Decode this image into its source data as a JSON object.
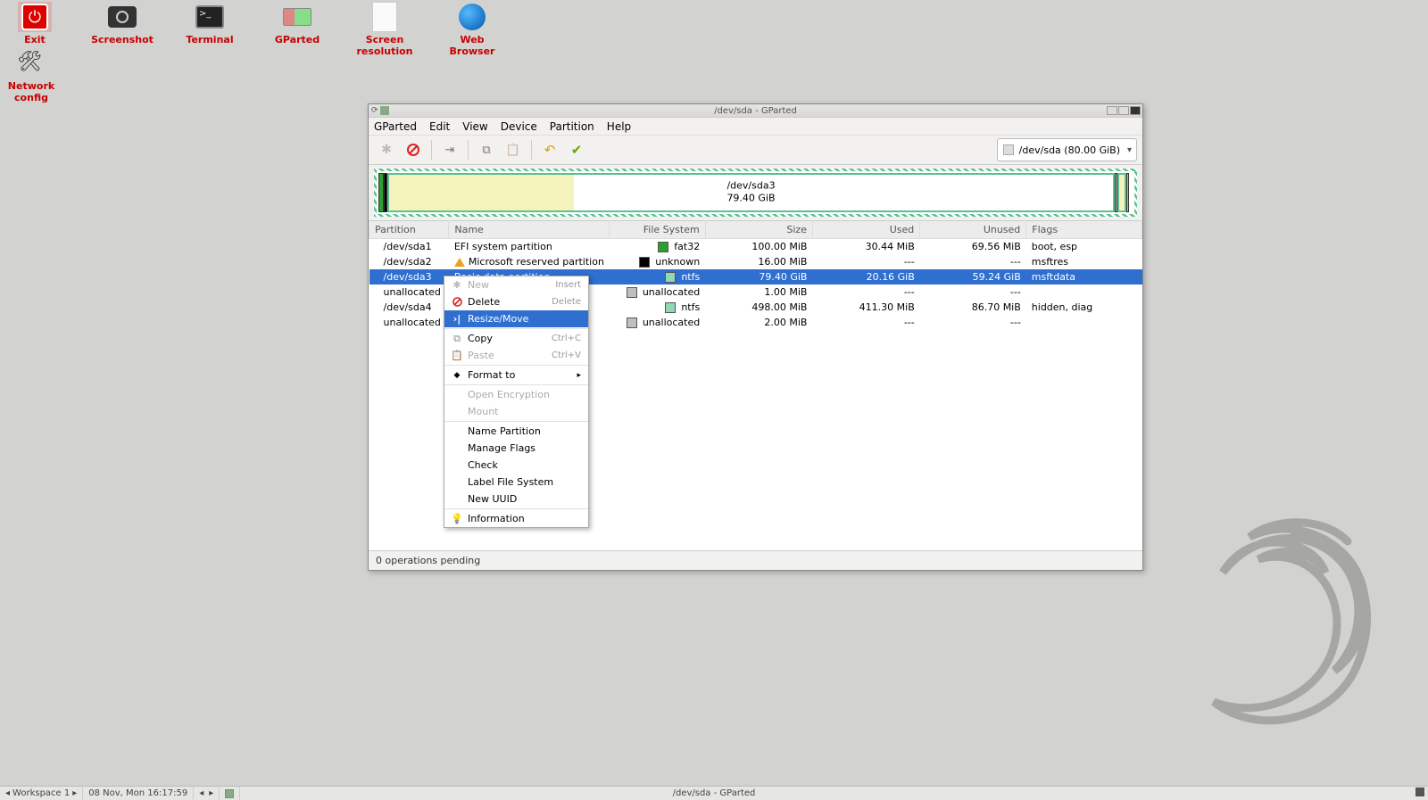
{
  "desktop_icons": [
    {
      "name": "Exit",
      "key": "exit"
    },
    {
      "name": "Screenshot",
      "key": "screenshot"
    },
    {
      "name": "Terminal",
      "key": "terminal"
    },
    {
      "name": "GParted",
      "key": "gparted"
    },
    {
      "name": "Screen resolution",
      "key": "screenres"
    },
    {
      "name": "Web Browser",
      "key": "webbrowser"
    }
  ],
  "desktop_icons_row2": [
    {
      "name": "Network config",
      "key": "netconfig"
    }
  ],
  "window": {
    "title": "/dev/sda - GParted",
    "menus": [
      "GParted",
      "Edit",
      "View",
      "Device",
      "Partition",
      "Help"
    ],
    "device_selector": "/dev/sda (80.00 GiB)",
    "diskmap": {
      "main_label_line1": "/dev/sda3",
      "main_label_line2": "79.40 GiB"
    },
    "columns": [
      "Partition",
      "Name",
      "File System",
      "Size",
      "Used",
      "Unused",
      "Flags"
    ],
    "rows": [
      {
        "partition": "/dev/sda1",
        "name": "EFI system partition",
        "fs": "fat32",
        "fscolor": "#2ca02c",
        "size": "100.00 MiB",
        "used": "30.44 MiB",
        "unused": "69.56 MiB",
        "flags": "boot, esp",
        "warn": false
      },
      {
        "partition": "/dev/sda2",
        "name": "Microsoft reserved partition",
        "fs": "unknown",
        "fscolor": "#000000",
        "size": "16.00 MiB",
        "used": "---",
        "unused": "---",
        "flags": "msftres",
        "warn": true
      },
      {
        "partition": "/dev/sda3",
        "name": "Basic data partition",
        "fs": "ntfs",
        "fscolor": "#8fd9b6",
        "size": "79.40 GiB",
        "used": "20.16 GiB",
        "unused": "59.24 GiB",
        "flags": "msftdata",
        "selected": true
      },
      {
        "partition": "unallocated",
        "name": "",
        "fs": "unallocated",
        "fscolor": "#bfbfbf",
        "size": "1.00 MiB",
        "used": "---",
        "unused": "---",
        "flags": ""
      },
      {
        "partition": "/dev/sda4",
        "name": "",
        "fs": "ntfs",
        "fscolor": "#8fd9b6",
        "size": "498.00 MiB",
        "used": "411.30 MiB",
        "unused": "86.70 MiB",
        "flags": "hidden, diag"
      },
      {
        "partition": "unallocated",
        "name": "",
        "fs": "unallocated",
        "fscolor": "#bfbfbf",
        "size": "2.00 MiB",
        "used": "---",
        "unused": "---",
        "flags": ""
      }
    ],
    "status": "0 operations pending"
  },
  "context_menu": {
    "items": [
      {
        "label": "New",
        "accel": "Insert",
        "icon": "plus",
        "disabled": true
      },
      {
        "label": "Delete",
        "accel": "Delete",
        "icon": "delete"
      },
      {
        "label": "Resize/Move",
        "icon": "resize",
        "selected": true
      },
      {
        "sep": true
      },
      {
        "label": "Copy",
        "accel": "Ctrl+C",
        "icon": "copy"
      },
      {
        "label": "Paste",
        "accel": "Ctrl+V",
        "icon": "paste",
        "disabled": true
      },
      {
        "sep": true
      },
      {
        "label": "Format to",
        "icon": "format",
        "submenu": true
      },
      {
        "sep": true
      },
      {
        "label": "Open Encryption",
        "disabled": true
      },
      {
        "label": "Mount",
        "disabled": true
      },
      {
        "sep": true
      },
      {
        "label": "Name Partition"
      },
      {
        "label": "Manage Flags"
      },
      {
        "label": "Check"
      },
      {
        "label": "Label File System"
      },
      {
        "label": "New UUID"
      },
      {
        "sep": true
      },
      {
        "label": "Information",
        "icon": "info"
      }
    ]
  },
  "taskbar": {
    "workspace": "Workspace 1",
    "datetime": "08 Nov, Mon 16:17:59",
    "task_title": "/dev/sda - GParted"
  }
}
